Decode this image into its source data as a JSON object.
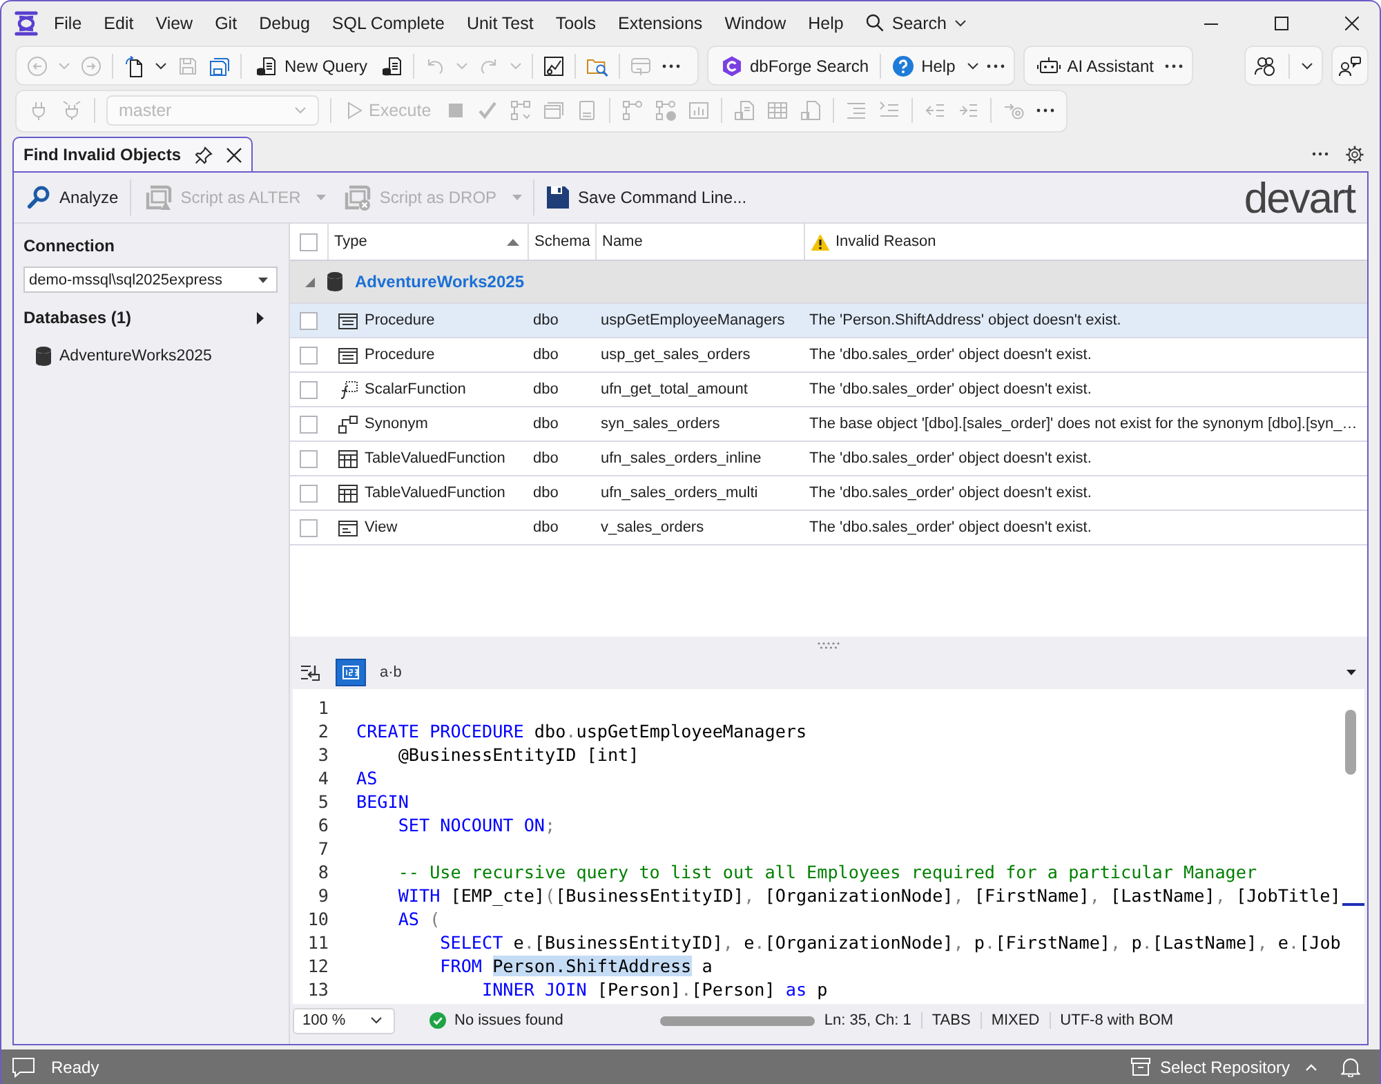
{
  "menu_bar": {
    "items": [
      {
        "label": "File"
      },
      {
        "label": "Edit"
      },
      {
        "label": "View"
      },
      {
        "label": "Git"
      },
      {
        "label": "Debug"
      },
      {
        "label": "SQL Complete"
      },
      {
        "label": "Unit Test"
      },
      {
        "label": "Tools"
      },
      {
        "label": "Extensions"
      },
      {
        "label": "Window"
      },
      {
        "label": "Help"
      }
    ],
    "search": {
      "label": "Search"
    }
  },
  "main_toolbar": {
    "new_query": {
      "label": "New Query"
    },
    "dbforge_search": {
      "label": "dbForge Search"
    },
    "help": {
      "label": "Help"
    },
    "ai_assistant": {
      "label": "AI Assistant"
    }
  },
  "query_toolbar": {
    "disabled": true,
    "database": {
      "value": "master"
    },
    "execute": {
      "label": "Execute"
    }
  },
  "document_tab": {
    "title": "Find Invalid Objects",
    "selected": true
  },
  "tool_toolbar": {
    "analyze": {
      "label": "Analyze",
      "disabled": false
    },
    "script_alter": {
      "label": "Script as ALTER",
      "disabled": true
    },
    "script_drop": {
      "label": "Script as DROP",
      "disabled": true
    },
    "save_command_line": {
      "label": "Save Command Line...",
      "disabled": false
    },
    "logo": "devart"
  },
  "connection_panel": {
    "connection_label": "Connection",
    "connection": {
      "value": "demo-mssql\\sql2025express"
    },
    "databases_label": "Databases (1)",
    "databases": [
      {
        "name": "AdventureWorks2025"
      }
    ]
  },
  "results_table": {
    "all_checked": false,
    "columns": {
      "type": {
        "label": "Type",
        "sort_ascending": true
      },
      "schema": {
        "label": "Schema"
      },
      "name": {
        "label": "Name"
      },
      "reason": {
        "label": "Invalid Reason"
      }
    },
    "groups": [
      {
        "name": "AdventureWorks2025",
        "expanded": true,
        "rows": [
          {
            "kind": "procedure",
            "type": "Procedure",
            "schema": "dbo",
            "name": "uspGetEmployeeManagers",
            "reason": "The 'Person.ShiftAddress' object doesn't exist.",
            "selected": true,
            "checked": false
          },
          {
            "kind": "procedure",
            "type": "Procedure",
            "schema": "dbo",
            "name": "usp_get_sales_orders",
            "reason": "The 'dbo.sales_order' object doesn't exist.",
            "selected": false,
            "checked": false
          },
          {
            "kind": "scalar_function",
            "type": "ScalarFunction",
            "schema": "dbo",
            "name": "ufn_get_total_amount",
            "reason": "The 'dbo.sales_order' object doesn't exist.",
            "selected": false,
            "checked": false
          },
          {
            "kind": "synonym",
            "type": "Synonym",
            "schema": "dbo",
            "name": "syn_sales_orders",
            "reason": "The base object '[dbo].[sales_order]' does not exist for the synonym [dbo].[syn_…",
            "selected": false,
            "checked": false
          },
          {
            "kind": "table_function",
            "type": "TableValuedFunction",
            "schema": "dbo",
            "name": "ufn_sales_orders_inline",
            "reason": "The 'dbo.sales_order' object doesn't exist.",
            "selected": false,
            "checked": false
          },
          {
            "kind": "table_function",
            "type": "TableValuedFunction",
            "schema": "dbo",
            "name": "ufn_sales_orders_multi",
            "reason": "The 'dbo.sales_order' object doesn't exist.",
            "selected": false,
            "checked": false
          },
          {
            "kind": "view",
            "type": "View",
            "schema": "dbo",
            "name": "v_sales_orders",
            "reason": "The 'dbo.sales_order' object doesn't exist.",
            "selected": false,
            "checked": false
          }
        ]
      }
    ]
  },
  "editor": {
    "toggles": [
      {
        "kind": "wrap",
        "on": false
      },
      {
        "kind": "line_numbers",
        "on": true
      },
      {
        "kind": "whitespace",
        "label": "a·b",
        "on": false
      }
    ],
    "lines": [
      {
        "number": "1"
      },
      {
        "number": "2",
        "tokens": [
          {
            "kind": "keyword",
            "text": "CREATE PROCEDURE"
          },
          {
            "kind": "plain",
            "text": " dbo"
          },
          {
            "kind": "punct",
            "text": "."
          },
          {
            "kind": "plain",
            "text": "uspGetEmployeeManagers"
          }
        ]
      },
      {
        "number": "3",
        "tokens": [
          {
            "kind": "plain",
            "text": "    @BusinessEntityID [int]"
          }
        ]
      },
      {
        "number": "4",
        "tokens": [
          {
            "kind": "keyword",
            "text": "AS"
          }
        ]
      },
      {
        "number": "5",
        "tokens": [
          {
            "kind": "keyword",
            "text": "BEGIN"
          }
        ]
      },
      {
        "number": "6",
        "tokens": [
          {
            "kind": "keyword",
            "text": "    SET NOCOUNT ON"
          },
          {
            "kind": "punct",
            "text": ";"
          }
        ]
      },
      {
        "number": "7"
      },
      {
        "number": "8",
        "tokens": [
          {
            "kind": "comment",
            "text": "    -- Use recursive query to list out all Employees required for a particular Manager"
          }
        ]
      },
      {
        "number": "9",
        "end_marker": true,
        "tokens": [
          {
            "kind": "keyword",
            "text": "    WITH"
          },
          {
            "kind": "plain",
            "text": " [EMP_cte]"
          },
          {
            "kind": "punct",
            "text": "("
          },
          {
            "kind": "plain",
            "text": "[BusinessEntityID]"
          },
          {
            "kind": "punct",
            "text": ", "
          },
          {
            "kind": "plain",
            "text": "[OrganizationNode]"
          },
          {
            "kind": "punct",
            "text": ", "
          },
          {
            "kind": "plain",
            "text": "[FirstName]"
          },
          {
            "kind": "punct",
            "text": ", "
          },
          {
            "kind": "plain",
            "text": "[LastName]"
          },
          {
            "kind": "punct",
            "text": ", "
          },
          {
            "kind": "plain",
            "text": "[JobTitle]"
          }
        ]
      },
      {
        "number": "10",
        "tokens": [
          {
            "kind": "keyword",
            "text": "    AS"
          },
          {
            "kind": "punct",
            "text": " ("
          }
        ]
      },
      {
        "number": "11",
        "tokens": [
          {
            "kind": "keyword",
            "text": "        SELECT"
          },
          {
            "kind": "plain",
            "text": " e"
          },
          {
            "kind": "punct",
            "text": "."
          },
          {
            "kind": "plain",
            "text": "[BusinessEntityID]"
          },
          {
            "kind": "punct",
            "text": ", "
          },
          {
            "kind": "plain",
            "text": "e"
          },
          {
            "kind": "punct",
            "text": "."
          },
          {
            "kind": "plain",
            "text": "[OrganizationNode]"
          },
          {
            "kind": "punct",
            "text": ", "
          },
          {
            "kind": "plain",
            "text": "p"
          },
          {
            "kind": "punct",
            "text": "."
          },
          {
            "kind": "plain",
            "text": "[FirstName]"
          },
          {
            "kind": "punct",
            "text": ", "
          },
          {
            "kind": "plain",
            "text": "p"
          },
          {
            "kind": "punct",
            "text": "."
          },
          {
            "kind": "plain",
            "text": "[LastName]"
          },
          {
            "kind": "punct",
            "text": ", "
          },
          {
            "kind": "plain",
            "text": "e"
          },
          {
            "kind": "punct",
            "text": "."
          },
          {
            "kind": "plain",
            "text": "[Job"
          }
        ]
      },
      {
        "number": "12",
        "tokens": [
          {
            "kind": "keyword",
            "text": "        FROM "
          },
          {
            "kind": "highlight",
            "text": "Person.ShiftAddress"
          },
          {
            "kind": "plain",
            "text": " a"
          }
        ]
      },
      {
        "number": "13",
        "tokens": [
          {
            "kind": "keyword",
            "text": "            INNER JOIN"
          },
          {
            "kind": "plain",
            "text": " [Person]"
          },
          {
            "kind": "punct",
            "text": "."
          },
          {
            "kind": "plain",
            "text": "[Person]"
          },
          {
            "kind": "keyword",
            "text": " as"
          },
          {
            "kind": "plain",
            "text": " p"
          }
        ]
      }
    ],
    "zoom": "100 %",
    "issues": "No issues found",
    "position": "Ln: 35, Ch: 1",
    "indentation": "TABS",
    "line_endings": "MIXED",
    "encoding": "UTF-8 with BOM"
  },
  "status_bar": {
    "text": "Ready",
    "repository": "Select Repository"
  }
}
